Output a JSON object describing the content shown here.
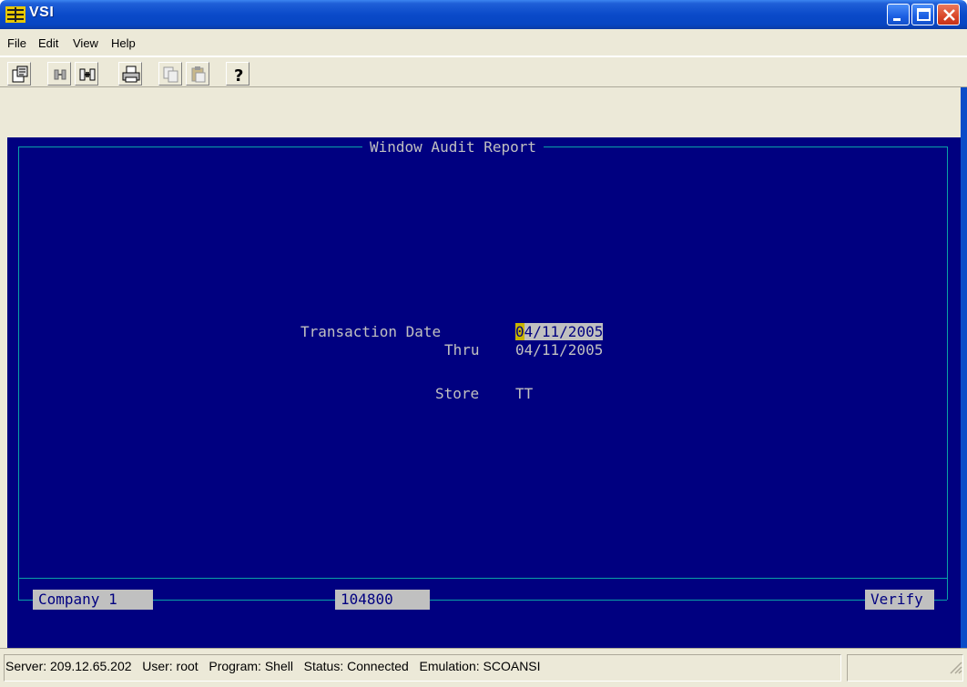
{
  "window": {
    "title": "VSI",
    "icon": "vsi-app-icon"
  },
  "menubar": {
    "items": [
      {
        "label": "File"
      },
      {
        "label": "Edit"
      },
      {
        "label": "View"
      },
      {
        "label": "Help"
      }
    ]
  },
  "toolbar": {
    "icons": [
      "properties-icon",
      "disconnect-icon",
      "connect-icon",
      "print-icon",
      "copy-icon",
      "paste-icon",
      "help-icon"
    ]
  },
  "terminal": {
    "report_title": "Window Audit Report",
    "fields": {
      "transaction_date_label": "Transaction Date",
      "transaction_date_cursor_char": "0",
      "transaction_date_rest": "4/11/2005",
      "thru_label": "Thru",
      "thru_value": "04/11/2005",
      "store_label": "Store",
      "store_value": "TT"
    },
    "footer": {
      "company": "Company 1",
      "code": "104800",
      "action": "Verify"
    },
    "colors": {
      "background": "#000080",
      "frame": "#0aa1a6",
      "text": "#c0c0c0",
      "cursor": "#c8b400"
    }
  },
  "statusbar": {
    "server": "Server: 209.12.65.202",
    "user": "User: root",
    "program": "Program: Shell",
    "status": "Status: Connected",
    "emulation": "Emulation: SCOANSI"
  }
}
